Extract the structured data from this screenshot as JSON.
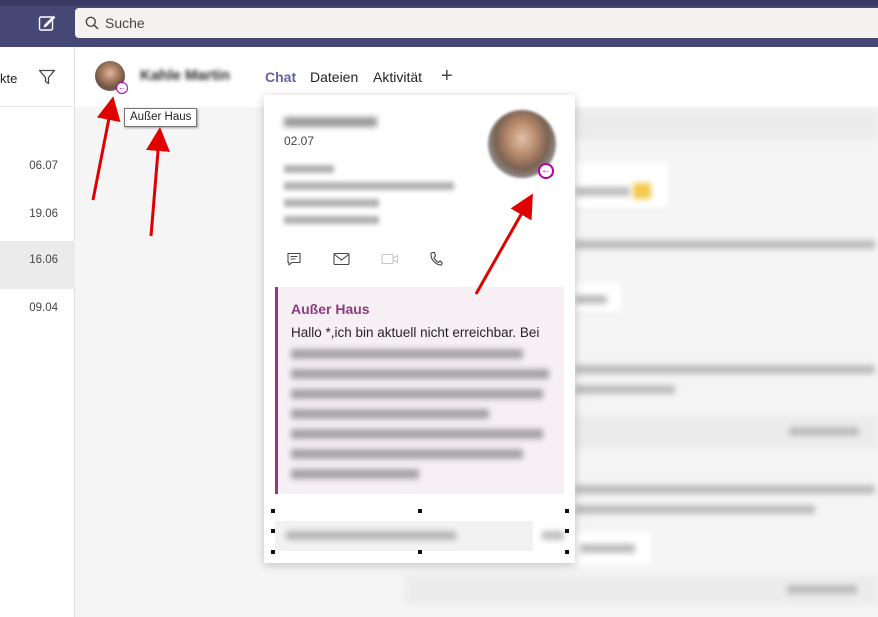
{
  "topbar": {
    "search_placeholder": "Suche"
  },
  "left_pane": {
    "title_fragment": "kte",
    "dates": [
      "06.07",
      "19.06",
      "16.06",
      "09.04"
    ],
    "selected_index": 2
  },
  "chat_header": {
    "tabs": [
      {
        "label": "Chat",
        "active": true
      },
      {
        "label": "Dateien",
        "active": false
      },
      {
        "label": "Aktivität",
        "active": false
      }
    ],
    "add_tab_symbol": "+"
  },
  "tooltip": {
    "text": "Außer Haus"
  },
  "contact_card": {
    "date": "02.07",
    "status_color": "#b4009e",
    "out_of_office": {
      "title": "Außer Haus",
      "first_line": "Hallo *,ich bin aktuell nicht erreichbar. Bei",
      "accent_color": "#8a3c7f"
    },
    "action_icons": [
      "chat-icon",
      "mail-icon",
      "video-icon",
      "phone-icon"
    ]
  },
  "colors": {
    "topbar": "#464775",
    "accent": "#6264a7",
    "annotation_arrow": "#e00000"
  }
}
